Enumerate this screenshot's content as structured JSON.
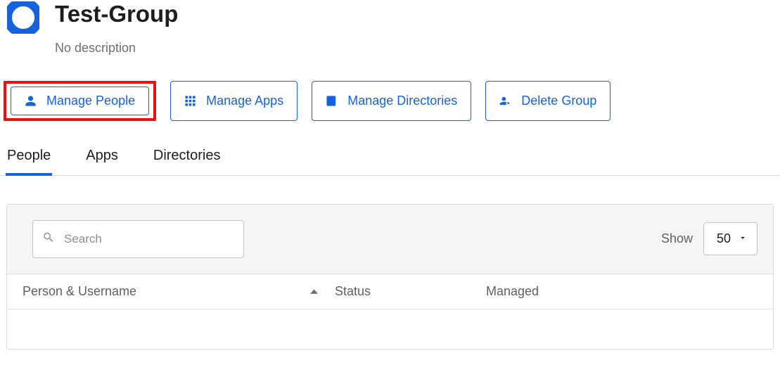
{
  "group": {
    "title": "Test-Group",
    "description": "No description"
  },
  "actions": {
    "manage_people": "Manage People",
    "manage_apps": "Manage Apps",
    "manage_directories": "Manage Directories",
    "delete_group": "Delete Group"
  },
  "tabs": {
    "people": "People",
    "apps": "Apps",
    "directories": "Directories"
  },
  "search": {
    "placeholder": "Search"
  },
  "pagination": {
    "show_label": "Show",
    "page_size": "50"
  },
  "columns": {
    "person": "Person & Username",
    "status": "Status",
    "managed": "Managed"
  }
}
